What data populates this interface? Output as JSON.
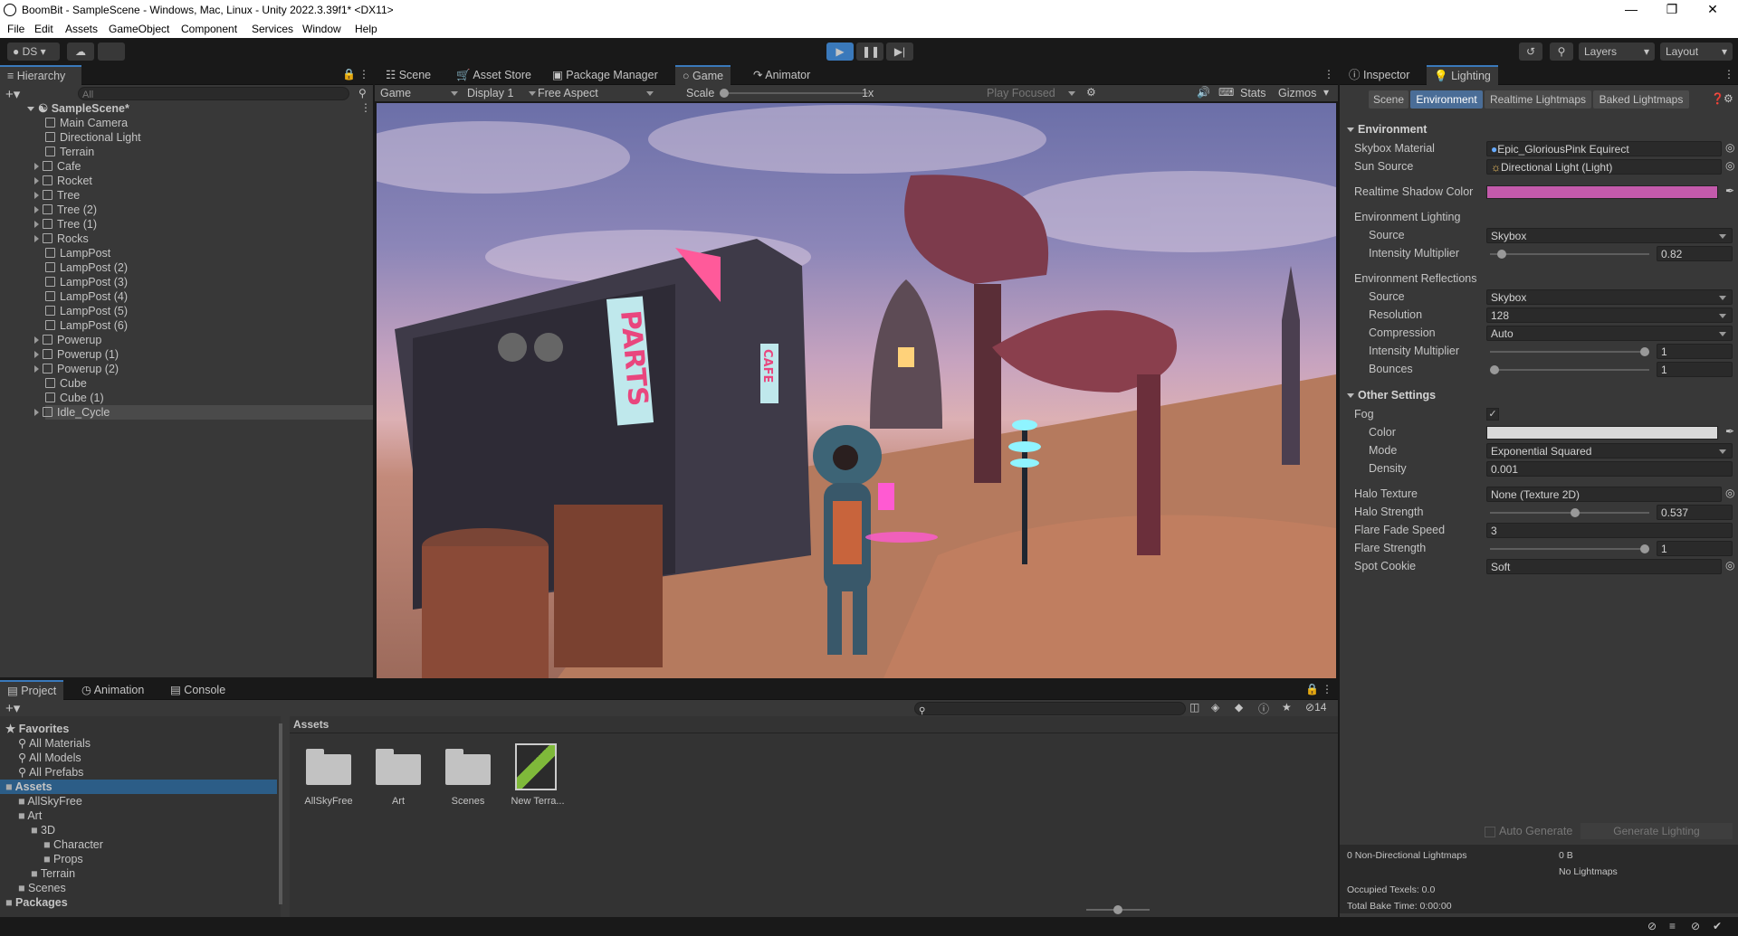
{
  "window": {
    "title": "BoomBit - SampleScene - Windows, Mac, Linux - Unity 2022.3.39f1* <DX11>"
  },
  "menu": [
    "File",
    "Edit",
    "Assets",
    "GameObject",
    "Component",
    "Services",
    "Window",
    "Help"
  ],
  "toolbar": {
    "account": "DS",
    "layers": "Layers",
    "layout": "Layout"
  },
  "hierarchy": {
    "tab": "Hierarchy",
    "search_placeholder": "All",
    "scene": "SampleScene*",
    "items": [
      {
        "label": "Main Camera",
        "exp": false
      },
      {
        "label": "Directional Light",
        "exp": false
      },
      {
        "label": "Terrain",
        "exp": false
      },
      {
        "label": "Cafe",
        "exp": true
      },
      {
        "label": "Rocket",
        "exp": true
      },
      {
        "label": "Tree",
        "exp": true
      },
      {
        "label": "Tree (2)",
        "exp": true
      },
      {
        "label": "Tree (1)",
        "exp": true
      },
      {
        "label": "Rocks",
        "exp": true
      },
      {
        "label": "LampPost",
        "exp": false
      },
      {
        "label": "LampPost (2)",
        "exp": false
      },
      {
        "label": "LampPost (3)",
        "exp": false
      },
      {
        "label": "LampPost (4)",
        "exp": false
      },
      {
        "label": "LampPost (5)",
        "exp": false
      },
      {
        "label": "LampPost (6)",
        "exp": false
      },
      {
        "label": "Powerup",
        "exp": true
      },
      {
        "label": "Powerup (1)",
        "exp": true
      },
      {
        "label": "Powerup (2)",
        "exp": true
      },
      {
        "label": "Cube",
        "exp": false
      },
      {
        "label": "Cube (1)",
        "exp": false
      },
      {
        "label": "Idle_Cycle",
        "exp": true
      }
    ]
  },
  "center_tabs": [
    "Scene",
    "Asset Store",
    "Package Manager",
    "Game",
    "Animator"
  ],
  "game_toolbar": {
    "view": "Game",
    "display": "Display 1",
    "aspect": "Free Aspect",
    "scale_label": "Scale",
    "scale_value": "1x",
    "play_mode": "Play Focused",
    "stats": "Stats",
    "gizmos": "Gizmos"
  },
  "viewport": {
    "sign_parts": "PARTS",
    "sign_cafe": "CAFE"
  },
  "inspector": {
    "tabs": [
      "Inspector",
      "Lighting"
    ],
    "subtabs": [
      "Scene",
      "Environment",
      "Realtime Lightmaps",
      "Baked Lightmaps"
    ],
    "environment": {
      "title": "Environment",
      "skybox_material_label": "Skybox Material",
      "skybox_material": "Epic_GloriousPink Equirect",
      "sun_source_label": "Sun Source",
      "sun_source": "Directional Light (Light)",
      "shadow_color_label": "Realtime Shadow Color",
      "shadow_color": "#c35aab",
      "env_lighting": "Environment Lighting",
      "source_label": "Source",
      "source": "Skybox",
      "intensity_label": "Intensity Multiplier",
      "intensity": "0.82",
      "intensity_frac": 0.05,
      "env_reflections": "Environment Reflections",
      "refl_source": "Skybox",
      "resolution_label": "Resolution",
      "resolution": "128",
      "compression_label": "Compression",
      "compression": "Auto",
      "refl_intensity": "1",
      "refl_intensity_frac": 1.0,
      "bounces_label": "Bounces",
      "bounces": "1",
      "bounces_frac": 0.0
    },
    "other": {
      "title": "Other Settings",
      "fog_label": "Fog",
      "fog_checked": true,
      "color_label": "Color",
      "fog_color": "#d9d9d9",
      "mode_label": "Mode",
      "mode": "Exponential Squared",
      "density_label": "Density",
      "density": "0.001",
      "halo_texture_label": "Halo Texture",
      "halo_texture": "None (Texture 2D)",
      "halo_strength_label": "Halo Strength",
      "halo_strength": "0.537",
      "halo_frac": 0.537,
      "flare_fade_label": "Flare Fade Speed",
      "flare_fade": "3",
      "flare_strength_label": "Flare Strength",
      "flare_strength": "1",
      "flare_frac": 1.0,
      "spot_cookie_label": "Spot Cookie",
      "spot_cookie": "Soft"
    },
    "auto_generate": "Auto Generate",
    "generate": "Generate Lighting",
    "stats": {
      "lightmaps": "0 Non-Directional Lightmaps",
      "size": "0 B",
      "no_lightmaps": "No Lightmaps",
      "texels": "Occupied Texels: 0.0",
      "bake_time": "Total Bake Time: 0:00:00"
    }
  },
  "project": {
    "tabs": [
      "Project",
      "Animation",
      "Console"
    ],
    "hidden_count": "14",
    "tree": [
      {
        "label": "Favorites",
        "level": 0,
        "bold": true
      },
      {
        "label": "All Materials",
        "level": 1
      },
      {
        "label": "All Models",
        "level": 1
      },
      {
        "label": "All Prefabs",
        "level": 1
      },
      {
        "label": "Assets",
        "level": 0,
        "bold": true,
        "selected": true
      },
      {
        "label": "AllSkyFree",
        "level": 1
      },
      {
        "label": "Art",
        "level": 1
      },
      {
        "label": "3D",
        "level": 2
      },
      {
        "label": "Character",
        "level": 3
      },
      {
        "label": "Props",
        "level": 3
      },
      {
        "label": "Terrain",
        "level": 2
      },
      {
        "label": "Scenes",
        "level": 1
      },
      {
        "label": "Packages",
        "level": 0,
        "bold": true
      }
    ],
    "breadcrumb": "Assets",
    "assets": [
      "AllSkyFree",
      "Art",
      "Scenes",
      "New Terra..."
    ]
  }
}
